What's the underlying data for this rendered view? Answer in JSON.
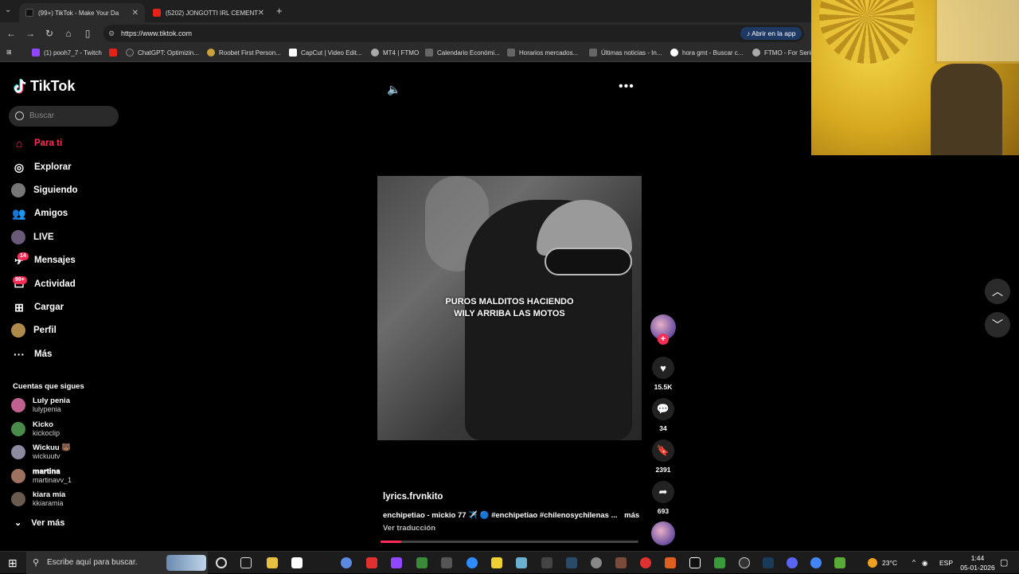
{
  "browser": {
    "tabs": [
      {
        "title": "(99+) TikTok - Make Your Da",
        "active": true
      },
      {
        "title": "(5202) JONGOTTI IRL CEMENT",
        "active": false
      }
    ],
    "url": "https://www.tiktok.com",
    "open_app": "Abrir en la app",
    "bookmarks": [
      "(1) pooh7_7 - Twitch",
      "ChatGPT: Optimizin...",
      "Roobet First Person...",
      "CapCut | Video Edit...",
      "MT4 | FTMO",
      "Calendario Económi...",
      "Horarios mercados...",
      "Últimas noticias - In...",
      "hora gmt - Buscar c...",
      "FTMO - For Serio"
    ]
  },
  "sidebar": {
    "logo": "TikTok",
    "search_placeholder": "Buscar",
    "nav": [
      {
        "label": "Para ti",
        "icon": "home-icon"
      },
      {
        "label": "Explorar",
        "icon": "compass-icon"
      },
      {
        "label": "Siguiendo",
        "icon": "following-avatar-icon"
      },
      {
        "label": "Amigos",
        "icon": "friends-icon"
      },
      {
        "label": "LIVE",
        "icon": "live-icon"
      },
      {
        "label": "Mensajes",
        "icon": "messages-icon",
        "badge": "14"
      },
      {
        "label": "Actividad",
        "icon": "activity-icon",
        "badge": "99+"
      },
      {
        "label": "Cargar",
        "icon": "upload-icon"
      },
      {
        "label": "Perfil",
        "icon": "profile-icon"
      },
      {
        "label": "Más",
        "icon": "more-icon"
      }
    ],
    "following_title": "Cuentas que sigues",
    "accounts": [
      {
        "name": "Luly penia",
        "user": "lulypenia"
      },
      {
        "name": "Kicko",
        "user": "kickoclip"
      },
      {
        "name": "Wickuu 🐻",
        "user": "wickuutv"
      },
      {
        "name": "𝐦𝐚𝐫𝐭𝐢𝐧𝐚",
        "user": "martinavv_1"
      },
      {
        "name": "kiara mía",
        "user": "kkiaramia"
      }
    ],
    "see_more": "Ver más"
  },
  "video": {
    "caption_line1": "PUROS MALDITOS HACIENDO",
    "caption_line2": "WILY ARRIBA LAS MOTOS",
    "author": "lyrics.frvnkito",
    "description": "enchipetiao - mickio 77 ✈️ 🔵 #enchipetiao #chilenosychilenas ...",
    "more": "más",
    "translate": "Ver traducción",
    "progress": 0.08
  },
  "actions": {
    "likes": "15.5K",
    "comments": "34",
    "saves": "2391",
    "shares": "693"
  },
  "taskbar": {
    "search_placeholder": "Escribe aquí para buscar.",
    "temp": "23°C",
    "lang": "ESP",
    "time": "1:44",
    "date": "05-01-2026"
  },
  "colors": {
    "accent": "#fe2c55",
    "background": "#000000"
  }
}
